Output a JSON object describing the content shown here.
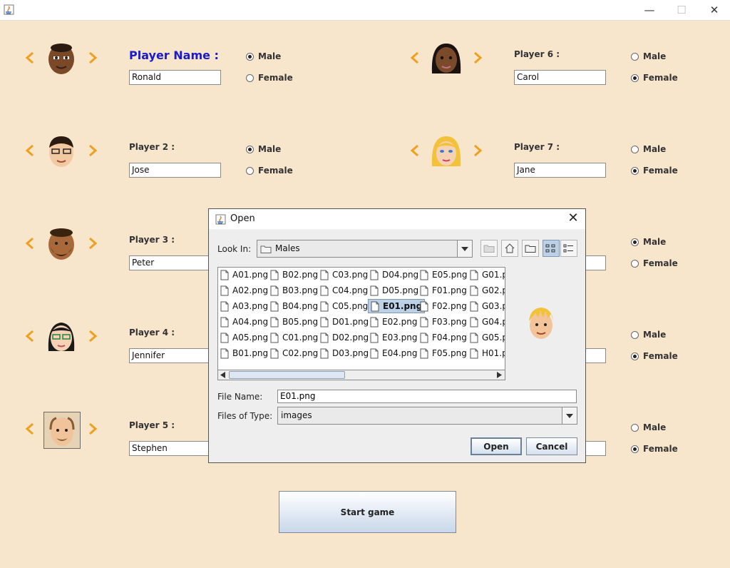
{
  "window": {
    "minimize_glyph": "—",
    "maximize_glyph": "☐",
    "close_glyph": "✕"
  },
  "players": [
    {
      "id": 1,
      "label": "Player Name :",
      "name": "Ronald",
      "gender": "male"
    },
    {
      "id": 2,
      "label": "Player 2 :",
      "name": "Jose",
      "gender": "male"
    },
    {
      "id": 3,
      "label": "Player 3 :",
      "name": "Peter",
      "gender": "male"
    },
    {
      "id": 4,
      "label": "Player 4 :",
      "name": "Jennifer",
      "gender": "female"
    },
    {
      "id": 5,
      "label": "Player 5 :",
      "name": "Stephen",
      "gender": "female"
    },
    {
      "id": 6,
      "label": "Player 6 :",
      "name": "Carol",
      "gender": "female"
    },
    {
      "id": 7,
      "label": "Player 7 :",
      "name": "Jane",
      "gender": "female"
    },
    {
      "id": 8,
      "label": "",
      "name": "",
      "gender": "male"
    },
    {
      "id": 9,
      "label": "",
      "name": "",
      "gender": "female"
    },
    {
      "id": 10,
      "label": "",
      "name": "",
      "gender": "female"
    }
  ],
  "gender_labels": {
    "male": "Male",
    "female": "Female"
  },
  "start_button": "Start game",
  "dialog": {
    "title": "Open",
    "look_in_label": "Look In:",
    "look_in_value": "Males",
    "files": [
      "A01.png",
      "A02.png",
      "A03.png",
      "A04.png",
      "A05.png",
      "B01.png",
      "B02.png",
      "B03.png",
      "B04.png",
      "B05.png",
      "C01.png",
      "C02.png",
      "C03.png",
      "C04.png",
      "C05.png",
      "D01.png",
      "D02.png",
      "D03.png",
      "D04.png",
      "D05.png",
      "E01.png",
      "E02.png",
      "E03.png",
      "E04.png",
      "E05.png",
      "F01.png",
      "F02.png",
      "F03.png",
      "F04.png",
      "F05.png",
      "G01.p",
      "G02.p",
      "G03.p",
      "G04.p",
      "G05.p",
      "H01.p"
    ],
    "selected_file": "E01.png",
    "file_name_label": "File Name:",
    "file_name_value": "E01.png",
    "files_of_type_label": "Files of Type:",
    "files_of_type_value": "images",
    "open_button": "Open",
    "cancel_button": "Cancel"
  },
  "colors": {
    "background": "#f7e5cc",
    "arrow": "#f0a020",
    "title_blue": "#1a1ad0"
  }
}
